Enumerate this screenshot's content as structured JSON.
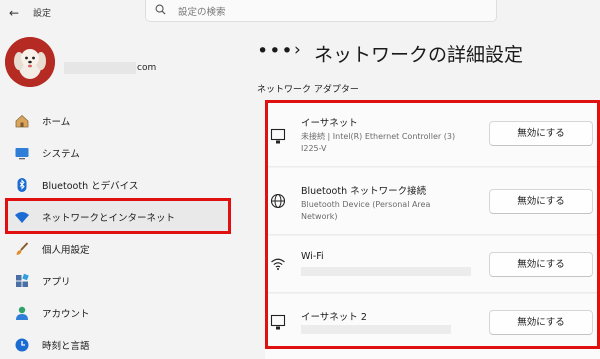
{
  "titlebar": {
    "title": "設定",
    "back_icon": "back-arrow-icon"
  },
  "search": {
    "placeholder": "設定の検索",
    "icon": "search-icon"
  },
  "account": {
    "email_suffix": "com"
  },
  "sidebar": {
    "items": [
      {
        "label": "ホーム",
        "icon": "home-icon",
        "active": false
      },
      {
        "label": "システム",
        "icon": "system-icon",
        "active": false
      },
      {
        "label": "Bluetooth とデバイス",
        "icon": "bluetooth-icon",
        "active": false
      },
      {
        "label": "ネットワークとインターネット",
        "icon": "wifi-icon",
        "active": true
      },
      {
        "label": "個人用設定",
        "icon": "brush-icon",
        "active": false
      },
      {
        "label": "アプリ",
        "icon": "apps-icon",
        "active": false
      },
      {
        "label": "アカウント",
        "icon": "account-icon",
        "active": false
      },
      {
        "label": "時刻と言語",
        "icon": "clock-icon",
        "active": false
      }
    ]
  },
  "header": {
    "breadcrumb_more": "•••",
    "separator": "›",
    "title": "ネットワークの詳細設定"
  },
  "section": {
    "title": "ネットワーク アダプター"
  },
  "adapters": [
    {
      "name": "イーサネット",
      "detail1": "未接続 | Intel(R) Ethernet Controller (3)",
      "detail2": "I225-V",
      "button": "無効にする",
      "icon": "ethernet-icon"
    },
    {
      "name": "Bluetooth ネットワーク接続",
      "detail1": "Bluetooth Device (Personal Area",
      "detail2": "Network)",
      "button": "無効にする",
      "icon": "globe-icon"
    },
    {
      "name": "Wi-Fi",
      "button": "無効にする",
      "icon": "wifi-icon"
    },
    {
      "name": "イーサネット 2",
      "button": "無効にする",
      "icon": "ethernet-icon"
    }
  ],
  "colors": {
    "highlight": "#e01010",
    "avatar_bg": "#b52a22",
    "wifi_blue": "#1b6bd3"
  }
}
